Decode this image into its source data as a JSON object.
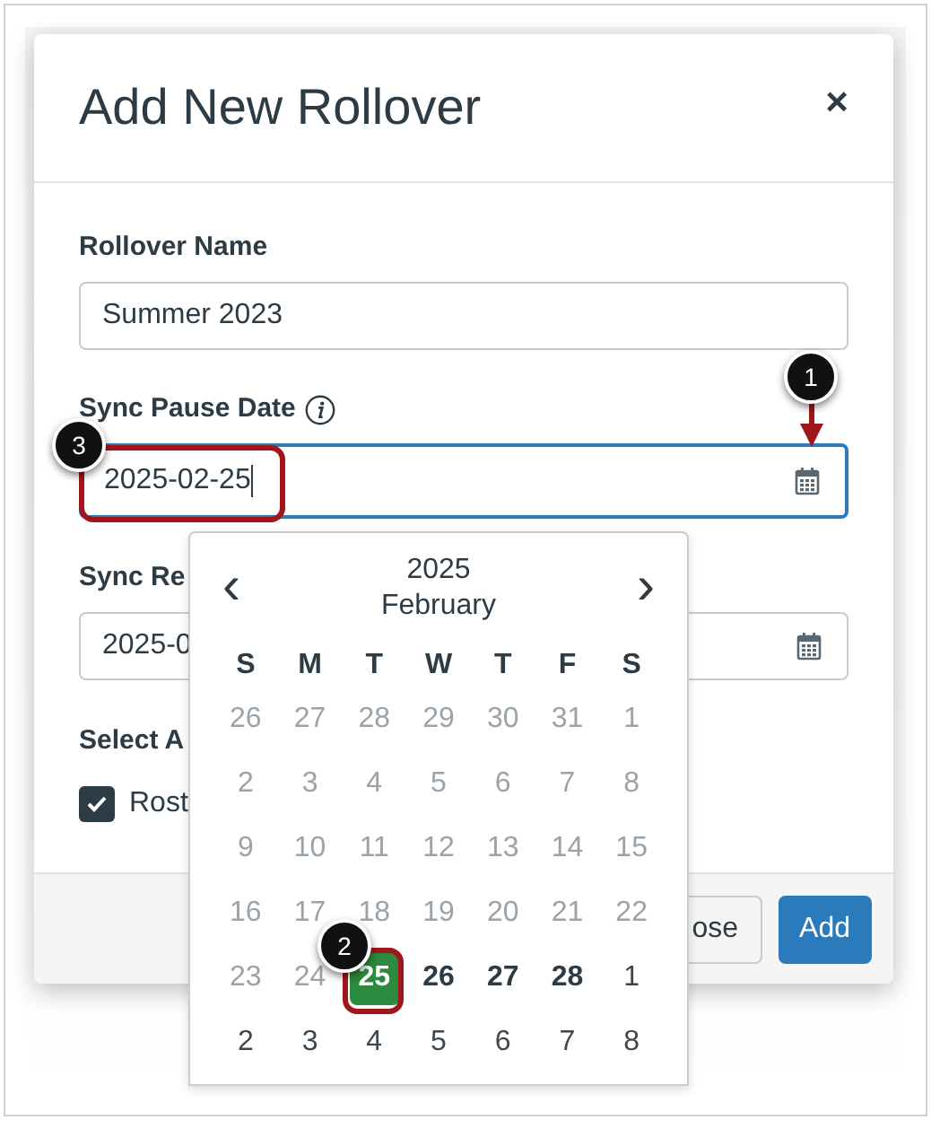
{
  "dialog": {
    "title": "Add New Rollover",
    "close_label": "×",
    "fields": [
      {
        "kind": "text",
        "label": "Rollover Name",
        "value": "Summer 2023",
        "focused": false
      },
      {
        "kind": "date",
        "label": "Sync Pause Date",
        "info": true,
        "value": "2025-02-25",
        "focused": true
      },
      {
        "kind": "date",
        "label": "Sync Re",
        "value": "2025-0",
        "focused": false
      }
    ],
    "section_label": "Select A",
    "checkbox": {
      "label": "Rost",
      "checked": true
    },
    "buttons": [
      {
        "label": "ose",
        "primary": false
      },
      {
        "label": "Add",
        "primary": true
      }
    ]
  },
  "calendar": {
    "year": "2025",
    "month": "February",
    "prev_label": "‹",
    "next_label": "›",
    "weekdays": [
      "S",
      "M",
      "T",
      "W",
      "T",
      "F",
      "S"
    ],
    "weeks": [
      [
        {
          "day": "26",
          "kind": "muted",
          "selected": false
        },
        {
          "day": "27",
          "kind": "muted",
          "selected": false
        },
        {
          "day": "28",
          "kind": "muted",
          "selected": false
        },
        {
          "day": "29",
          "kind": "muted",
          "selected": false
        },
        {
          "day": "30",
          "kind": "muted",
          "selected": false
        },
        {
          "day": "31",
          "kind": "muted",
          "selected": false
        },
        {
          "day": "1",
          "kind": "muted",
          "selected": false
        }
      ],
      [
        {
          "day": "2",
          "kind": "muted",
          "selected": false
        },
        {
          "day": "3",
          "kind": "muted",
          "selected": false
        },
        {
          "day": "4",
          "kind": "muted",
          "selected": false
        },
        {
          "day": "5",
          "kind": "muted",
          "selected": false
        },
        {
          "day": "6",
          "kind": "muted",
          "selected": false
        },
        {
          "day": "7",
          "kind": "muted",
          "selected": false
        },
        {
          "day": "8",
          "kind": "muted",
          "selected": false
        }
      ],
      [
        {
          "day": "9",
          "kind": "muted",
          "selected": false
        },
        {
          "day": "10",
          "kind": "muted",
          "selected": false
        },
        {
          "day": "11",
          "kind": "muted",
          "selected": false
        },
        {
          "day": "12",
          "kind": "muted",
          "selected": false
        },
        {
          "day": "13",
          "kind": "muted",
          "selected": false
        },
        {
          "day": "14",
          "kind": "muted",
          "selected": false
        },
        {
          "day": "15",
          "kind": "muted",
          "selected": false
        }
      ],
      [
        {
          "day": "16",
          "kind": "muted",
          "selected": false
        },
        {
          "day": "17",
          "kind": "muted",
          "selected": false
        },
        {
          "day": "18",
          "kind": "muted",
          "selected": false
        },
        {
          "day": "19",
          "kind": "muted",
          "selected": false
        },
        {
          "day": "20",
          "kind": "muted",
          "selected": false
        },
        {
          "day": "21",
          "kind": "muted",
          "selected": false
        },
        {
          "day": "22",
          "kind": "muted",
          "selected": false
        }
      ],
      [
        {
          "day": "23",
          "kind": "muted",
          "selected": false
        },
        {
          "day": "24",
          "kind": "muted",
          "selected": false
        },
        {
          "day": "25",
          "kind": "current",
          "selected": true
        },
        {
          "day": "26",
          "kind": "current",
          "selected": false
        },
        {
          "day": "27",
          "kind": "current",
          "selected": false
        },
        {
          "day": "28",
          "kind": "current",
          "selected": false
        },
        {
          "day": "1",
          "kind": "adjacent",
          "selected": false
        }
      ],
      [
        {
          "day": "2",
          "kind": "adjacent",
          "selected": false
        },
        {
          "day": "3",
          "kind": "adjacent",
          "selected": false
        },
        {
          "day": "4",
          "kind": "adjacent",
          "selected": false
        },
        {
          "day": "5",
          "kind": "adjacent",
          "selected": false
        },
        {
          "day": "6",
          "kind": "adjacent",
          "selected": false
        },
        {
          "day": "7",
          "kind": "adjacent",
          "selected": false
        },
        {
          "day": "8",
          "kind": "adjacent",
          "selected": false
        }
      ]
    ]
  },
  "callouts": [
    {
      "number": "1",
      "kind": "arrow"
    },
    {
      "number": "2",
      "kind": "frame"
    },
    {
      "number": "3",
      "kind": "frame"
    }
  ]
}
